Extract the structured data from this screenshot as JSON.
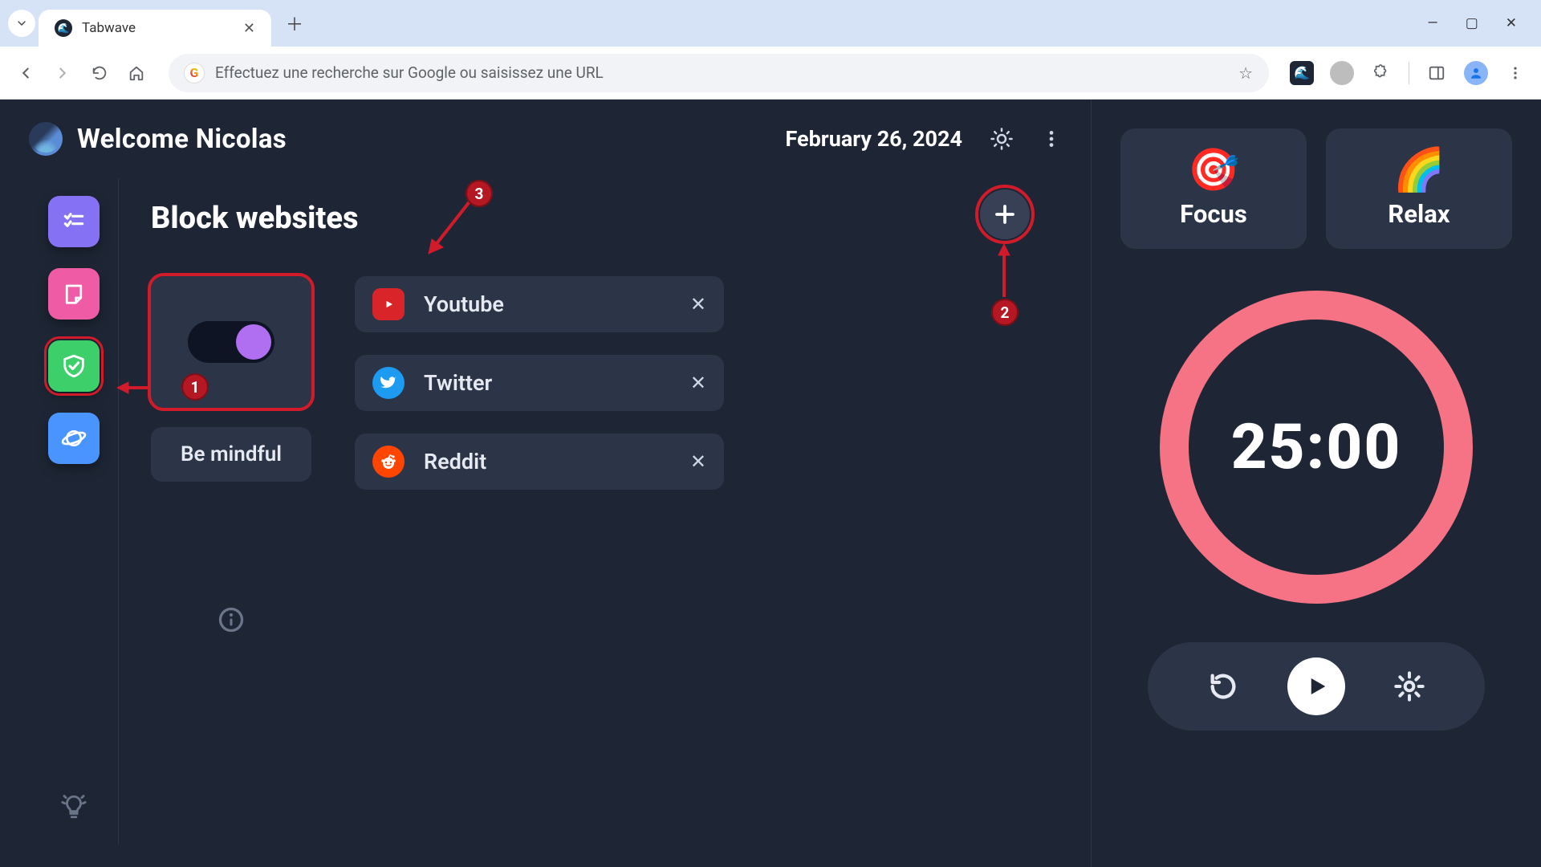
{
  "browser": {
    "tab_title": "Tabwave",
    "omnibox_placeholder": "Effectuez une recherche sur Google ou saisissez une URL"
  },
  "header": {
    "welcome": "Welcome Nicolas",
    "date": "February 26, 2024"
  },
  "section": {
    "title": "Block websites",
    "be_mindful": "Be mindful"
  },
  "sites": [
    {
      "name": "Youtube",
      "icon": "youtube"
    },
    {
      "name": "Twitter",
      "icon": "twitter"
    },
    {
      "name": "Reddit",
      "icon": "reddit"
    }
  ],
  "modes": {
    "focus": "Focus",
    "relax": "Relax"
  },
  "timer": {
    "display": "25:00"
  },
  "annotations": {
    "callout_1": "1",
    "callout_2": "2",
    "callout_3": "3"
  }
}
